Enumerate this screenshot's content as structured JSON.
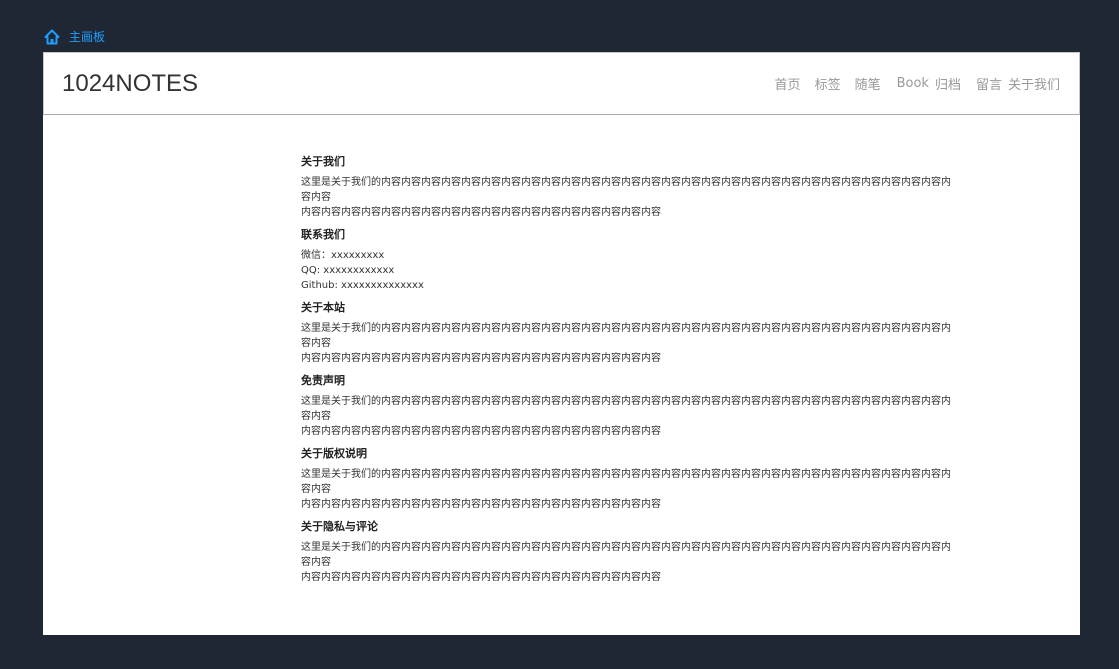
{
  "breadcrumb": {
    "label": "主画板",
    "icon": "home-icon",
    "color": "#1e9fff"
  },
  "header": {
    "logo": "1024NOTES",
    "nav": [
      "首页",
      "标签",
      "随笔",
      "Book",
      "归档",
      "留言",
      "关于我们"
    ]
  },
  "sections": [
    {
      "title": "关于我们",
      "lines": [
        "这里是关于我们的内容内容内容内容内容内容内容内容内容内容内容内容内容内容内容内容内容内容内容内容内容内容内容内容内容内容内容内容内容内容",
        "内容内容内容内容内容内容内容内容内容内容内容内容内容内容内容内容内容内容"
      ]
    },
    {
      "title": "联系我们",
      "lines": [
        "微信：xxxxxxxxx",
        "QQ: xxxxxxxxxxxx",
        "Github: xxxxxxxxxxxxxx"
      ]
    },
    {
      "title": "关于本站",
      "lines": [
        "这里是关于我们的内容内容内容内容内容内容内容内容内容内容内容内容内容内容内容内容内容内容内容内容内容内容内容内容内容内容内容内容内容内容",
        "内容内容内容内容内容内容内容内容内容内容内容内容内容内容内容内容内容内容"
      ]
    },
    {
      "title": "免责声明",
      "lines": [
        "这里是关于我们的内容内容内容内容内容内容内容内容内容内容内容内容内容内容内容内容内容内容内容内容内容内容内容内容内容内容内容内容内容内容",
        "内容内容内容内容内容内容内容内容内容内容内容内容内容内容内容内容内容内容"
      ]
    },
    {
      "title": "关于版权说明",
      "lines": [
        "这里是关于我们的内容内容内容内容内容内容内容内容内容内容内容内容内容内容内容内容内容内容内容内容内容内容内容内容内容内容内容内容内容内容",
        "内容内容内容内容内容内容内容内容内容内容内容内容内容内容内容内容内容内容"
      ]
    },
    {
      "title": "关于隐私与评论",
      "lines": [
        "这里是关于我们的内容内容内容内容内容内容内容内容内容内容内容内容内容内容内容内容内容内容内容内容内容内容内容内容内容内容内容内容内容内容",
        "内容内容内容内容内容内容内容内容内容内容内容内容内容内容内容内容内容内容"
      ]
    }
  ]
}
